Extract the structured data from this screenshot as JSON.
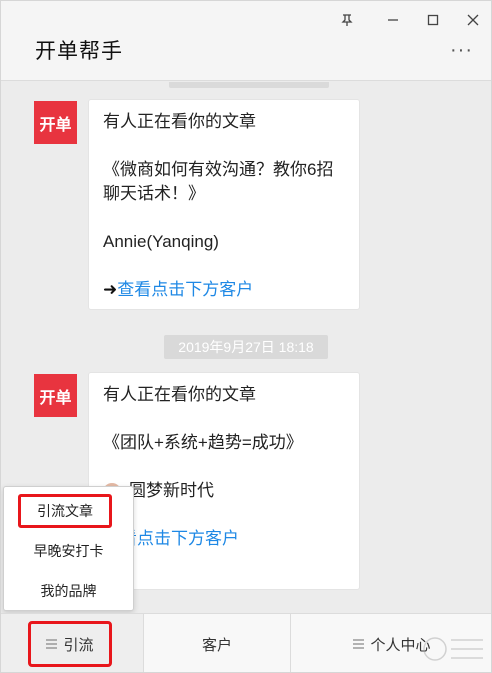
{
  "window": {
    "title": "开单帮手",
    "more": "···"
  },
  "messages": [
    {
      "avatar": "开单",
      "heading": "有人正在看你的文章",
      "article": "《微商如何有效沟通？教你6招聊天话术！》",
      "author": "Annie(Yanqing)",
      "arrow": "➜",
      "link": "查看点击下方客户"
    },
    {
      "avatar": "开单",
      "heading": "有人正在看你的文章",
      "article": "《团队+系统+趋势=成功》",
      "author": "圆梦新时代",
      "link": "查看点击下方客户"
    }
  ],
  "timestamp": "2019年9月27日 18:18",
  "popup_menu": {
    "items": [
      "引流文章",
      "早晚安打卡",
      "我的品牌"
    ]
  },
  "bottom_tabs": [
    {
      "label": "引流"
    },
    {
      "label": "客户"
    },
    {
      "label": "个人中心"
    }
  ],
  "colors": {
    "brand_red": "#e8343f",
    "highlight_red": "#e8161b",
    "link_blue": "#1e88e5"
  }
}
